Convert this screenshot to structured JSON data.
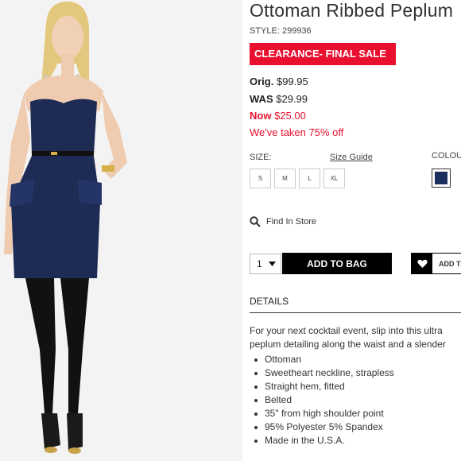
{
  "product": {
    "title": "Ottoman Ribbed Peplum",
    "style": "STYLE: 299936",
    "clearance_badge": "CLEARANCE- FINAL SALE",
    "orig_label": "Orig.",
    "orig_price": "$99.95",
    "was_label": "WAS",
    "was_price": "$29.99",
    "now_label": "Now",
    "now_price": "$25.00",
    "discount_text": "We've taken 75% off"
  },
  "sizes": {
    "label": "SIZE:",
    "guide_link": "Size Guide",
    "options": [
      "S",
      "M",
      "L",
      "XL"
    ]
  },
  "color": {
    "label": "COLOUR",
    "swatch_color": "#1b2f5e"
  },
  "find_in_store": "Find In Store",
  "cart": {
    "quantity": "1",
    "add_to_bag": "ADD TO BAG",
    "wishlist_label": "ADD T"
  },
  "details": {
    "heading": "DETAILS",
    "description_lines": [
      "For your next cocktail event, slip into this ultra",
      "peplum detailing along the waist and a slender"
    ],
    "bullets": [
      "Ottoman",
      "Sweetheart neckline, strapless",
      "Straight hem, fitted",
      "Belted",
      "35\" from high shoulder point",
      "95% Polyester 5% Spandex",
      "Made in the U.S.A."
    ]
  }
}
